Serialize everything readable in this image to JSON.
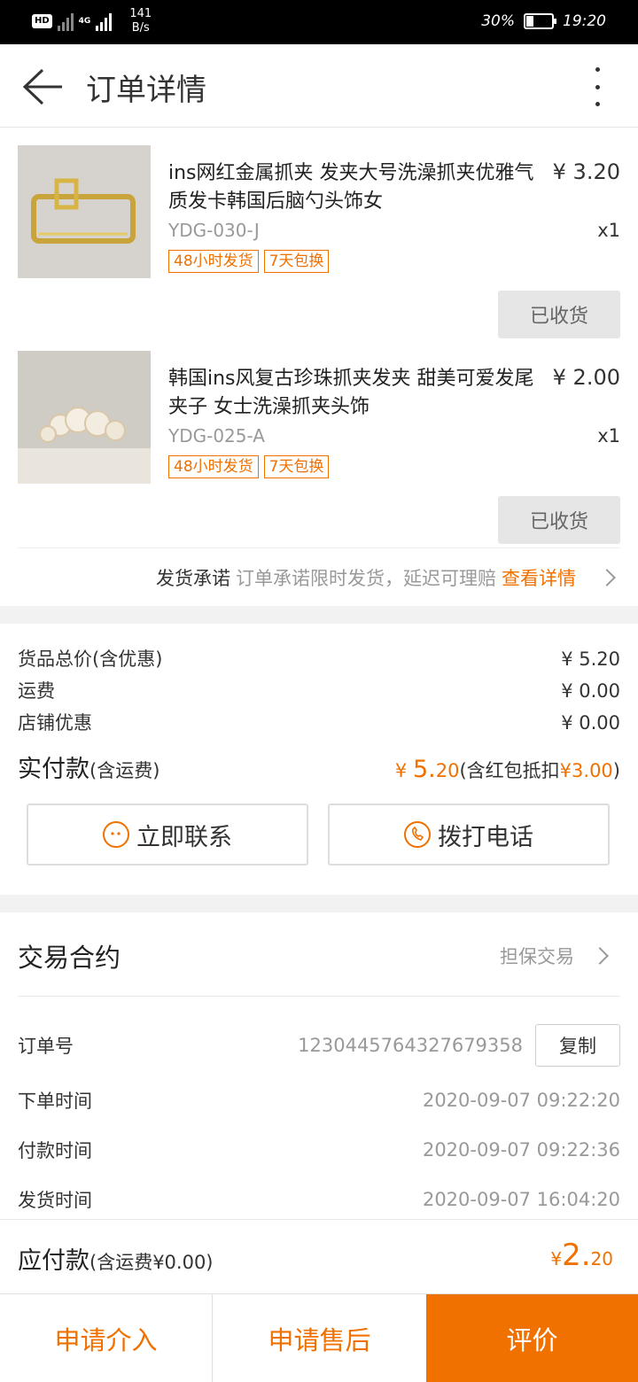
{
  "status_bar": {
    "hd_badge": "HD",
    "network": "4G",
    "speed_value": "141",
    "speed_unit": "B/s",
    "battery": "30%",
    "battery_level": 0.3,
    "time": "19:20"
  },
  "header": {
    "title": "订单详情",
    "back_icon": "arrow-left-icon",
    "more_icon": "more-vertical-icon"
  },
  "products": [
    {
      "name": "ins网红金属抓夹 发夹大号洗澡抓夹优雅气质发卡韩国后脑勺头饰女",
      "price": "¥ 3.20",
      "sku": "YDG-030-J",
      "qty": "x1",
      "tags": [
        "48小时发货",
        "7天包换"
      ],
      "status_button": "已收货"
    },
    {
      "name": "韩国ins风复古珍珠抓夹发夹 甜美可爱发尾夹子 女士洗澡抓夹头饰",
      "price": "¥ 2.00",
      "sku": "YDG-025-A",
      "qty": "x1",
      "tags": [
        "48小时发货",
        "7天包换"
      ],
      "status_button": "已收货"
    }
  ],
  "promise": {
    "label": "发货承诺",
    "text": "订单承诺限时发货，延迟可理赔",
    "link": "查看详情"
  },
  "summary": {
    "goods_total_label": "货品总价(含优惠)",
    "goods_total_value": "¥ 5.20",
    "shipping_label": "运费",
    "shipping_value": "¥ 0.00",
    "store_discount_label": "店铺优惠",
    "store_discount_value": "¥ 0.00",
    "paid_label": "实付款",
    "paid_label_note": "(含运费)",
    "paid_currency": "¥",
    "paid_int": "5.",
    "paid_dec": "20",
    "paid_note_prefix": "(含红包抵扣",
    "paid_note_amount": "¥3.00",
    "paid_note_suffix": ")"
  },
  "contact": {
    "chat_label": "立即联系",
    "call_label": "拨打电话"
  },
  "contract": {
    "title": "交易合约",
    "type": "担保交易",
    "order_no_label": "订单号",
    "order_no": "1230445764327679358",
    "copy_label": "复制",
    "order_time_label": "下单时间",
    "order_time": "2020-09-07 09:22:20",
    "pay_time_label": "付款时间",
    "pay_time": "2020-09-07 09:22:36",
    "ship_time_label": "发货时间",
    "ship_time": "2020-09-07 16:04:20"
  },
  "payable": {
    "label": "应付款",
    "note": "(含运费¥0.00)",
    "currency": "¥",
    "int": "2.",
    "dec": "20"
  },
  "bottom_actions": {
    "intervene": "申请介入",
    "after_sale": "申请售后",
    "review": "评价"
  },
  "colors": {
    "accent": "#f07000",
    "status_bar": "#000000"
  }
}
